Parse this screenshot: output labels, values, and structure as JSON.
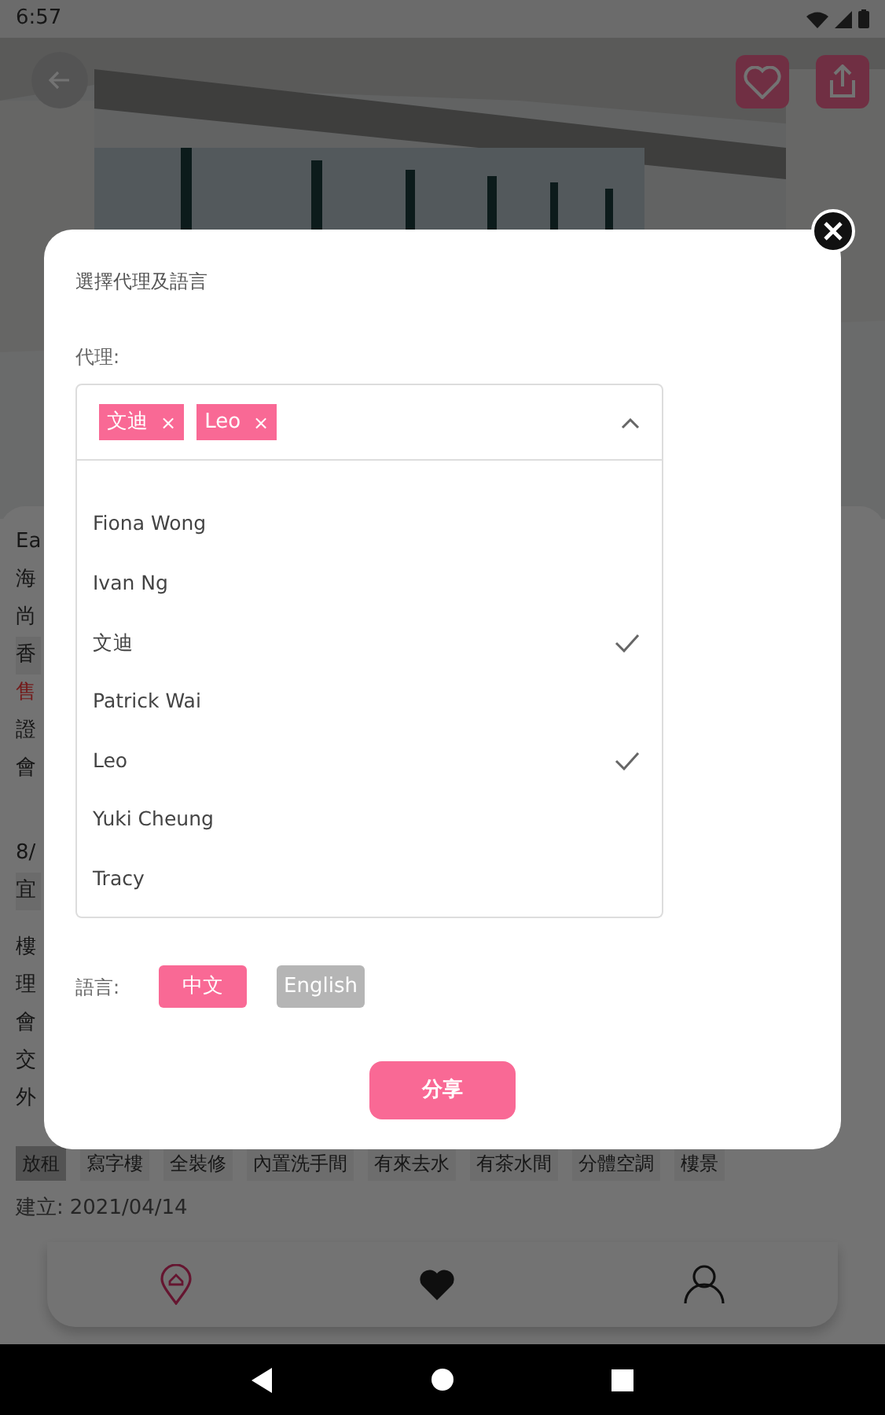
{
  "status_bar": {
    "time": "6:57"
  },
  "background": {
    "groups": [
      [
        {
          "text": "Ea",
          "kind": "text"
        },
        {
          "text": "海",
          "kind": "text"
        },
        {
          "text": "尚",
          "kind": "text"
        },
        {
          "text": "香",
          "kind": "tag"
        },
        {
          "text": "售",
          "kind": "alert"
        },
        {
          "text": "證",
          "kind": "text"
        },
        {
          "text": "會",
          "kind": "text"
        }
      ],
      [
        {
          "text": "8/",
          "kind": "text"
        },
        {
          "text": "宜",
          "kind": "tag"
        }
      ],
      [
        {
          "text": "樓",
          "kind": "text"
        },
        {
          "text": "理",
          "kind": "text"
        },
        {
          "text": "會",
          "kind": "text"
        },
        {
          "text": "交",
          "kind": "text"
        },
        {
          "text": "外",
          "kind": "text"
        }
      ]
    ],
    "tags": [
      {
        "label": "放租",
        "selected": true
      },
      {
        "label": "寫字樓",
        "selected": false
      },
      {
        "label": "全裝修",
        "selected": false
      },
      {
        "label": "內置洗手間",
        "selected": false
      },
      {
        "label": "有來去水",
        "selected": false
      },
      {
        "label": "有茶水間",
        "selected": false
      },
      {
        "label": "分體空調",
        "selected": false
      },
      {
        "label": "樓景",
        "selected": false
      }
    ],
    "created": {
      "label": "建立:",
      "value": "2021/04/14"
    }
  },
  "bottom_nav": [
    {
      "selected": true
    },
    {
      "selected": false
    },
    {
      "selected": false
    }
  ],
  "dialog": {
    "title": "選擇代理及語言",
    "agent_label": "代理:",
    "selected_agents": [
      {
        "label": "文迪",
        "remove": "×"
      },
      {
        "label": "Leo",
        "remove": "×"
      }
    ],
    "expanded": true,
    "options": [
      {
        "label": "Fiona Wong",
        "checked": false
      },
      {
        "label": "Ivan Ng",
        "checked": false
      },
      {
        "label": "文迪",
        "checked": true
      },
      {
        "label": "Patrick Wai",
        "checked": false
      },
      {
        "label": "Leo",
        "checked": true
      },
      {
        "label": "Yuki Cheung",
        "checked": false
      },
      {
        "label": "Tracy",
        "checked": false
      }
    ],
    "language_label": "語言:",
    "languages": [
      {
        "label": "中文",
        "selected": true
      },
      {
        "label": "English",
        "selected": false
      }
    ],
    "share_button": "分享"
  }
}
